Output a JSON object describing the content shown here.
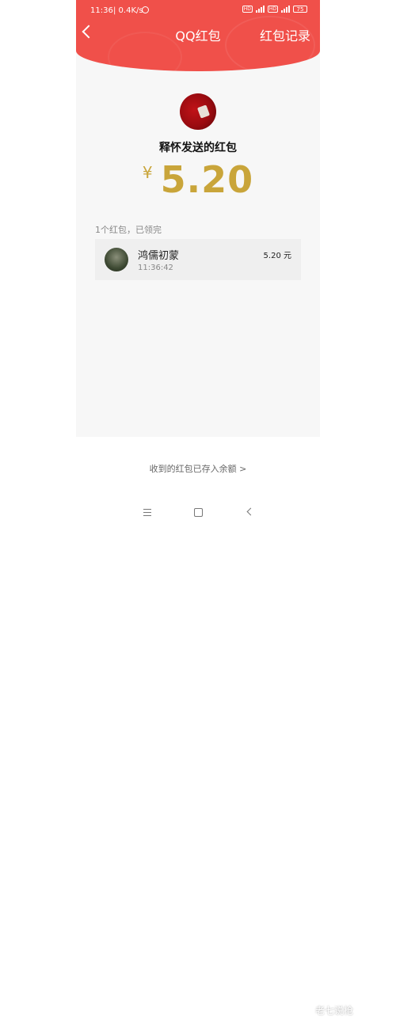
{
  "status_bar": {
    "time": "11:36",
    "network_speed": "| 0.4K/s",
    "hd1": "HD",
    "hd2": "HD",
    "battery": "75"
  },
  "nav": {
    "title": "QQ红包",
    "records_label": "红包记录"
  },
  "sender": {
    "title": "释怀发送的红包"
  },
  "amount": {
    "currency": "¥",
    "value": "5.20"
  },
  "summary": "1个红包，已领完",
  "records": [
    {
      "name": "鸿儒初蒙",
      "time": "11:36:42",
      "amount": "5.20 元"
    }
  ],
  "footer": {
    "balance_link": "收到的红包已存入余额 >"
  },
  "watermark": "老七说枪",
  "colors": {
    "header_red": "#f0504a",
    "amount_gold": "#c9a53a"
  }
}
